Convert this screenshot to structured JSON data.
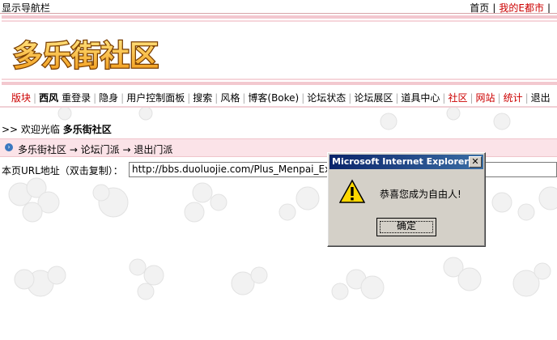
{
  "topbar": {
    "show_nav": "显示导航栏",
    "home": "首页",
    "my_city": "我的E都市"
  },
  "header": {
    "logo_text": "多乐街社区"
  },
  "menu": {
    "items": [
      {
        "label": "版块",
        "color": "red"
      },
      {
        "label": "西风",
        "color": "bold"
      },
      {
        "label": "重登录",
        "color": "normal"
      },
      {
        "label": "隐身",
        "color": "normal"
      },
      {
        "label": "用户控制面板",
        "color": "normal"
      },
      {
        "label": "搜索",
        "color": "normal"
      },
      {
        "label": "风格",
        "color": "normal"
      },
      {
        "label": "博客(Boke)",
        "color": "normal"
      },
      {
        "label": "论坛状态",
        "color": "normal"
      },
      {
        "label": "论坛展区",
        "color": "normal"
      },
      {
        "label": "道具中心",
        "color": "normal"
      },
      {
        "label": "社区",
        "color": "red"
      },
      {
        "label": "网站",
        "color": "red"
      },
      {
        "label": "统计",
        "color": "red"
      },
      {
        "label": "退出",
        "color": "normal"
      }
    ]
  },
  "welcome": {
    "prefix": ">> 欢迎光临",
    "site": "多乐街社区"
  },
  "breadcrumb": {
    "text": "多乐街社区 → 论坛门派 → 退出门派"
  },
  "url": {
    "label": "本页URL地址（双击复制）：",
    "value": "http://bbs.duoluojie.com/Plus_Menpai_Exit.asp"
  },
  "dialog": {
    "title": "Microsoft Internet Explorer",
    "message": "恭喜您成为自由人!",
    "ok": "确定"
  },
  "colors": {
    "accent": "#cc0000",
    "pink": "#fbe3e8",
    "titlebar": "#0a246a"
  }
}
